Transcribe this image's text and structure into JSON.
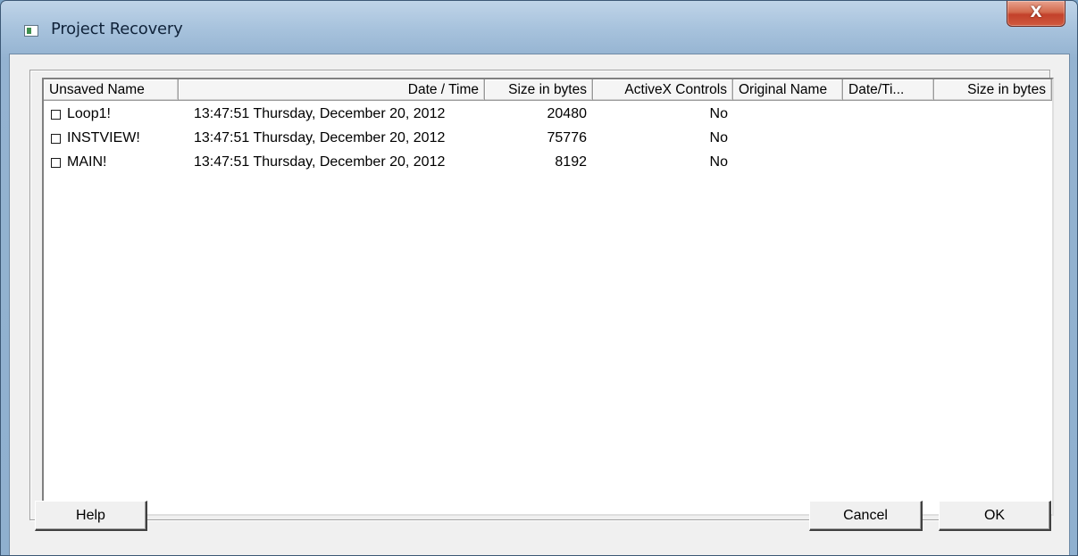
{
  "window": {
    "title": "Project Recovery",
    "close_glyph": "X",
    "icon": "window-app-icon"
  },
  "list": {
    "columns": [
      {
        "label": "Unsaved Name",
        "align": "left"
      },
      {
        "label": "Date / Time",
        "align": "right"
      },
      {
        "label": "Size in bytes",
        "align": "right"
      },
      {
        "label": "ActiveX Controls",
        "align": "right"
      },
      {
        "label": "Original Name",
        "align": "left"
      },
      {
        "label": "Date/Ti...",
        "align": "left"
      },
      {
        "label": "Size in bytes",
        "align": "right"
      }
    ],
    "rows": [
      {
        "name": "Loop1!",
        "datetime": "13:47:51 Thursday, December 20, 2012",
        "size": "20480",
        "activex": "No",
        "checked": false
      },
      {
        "name": "INSTVIEW!",
        "datetime": "13:47:51 Thursday, December 20, 2012",
        "size": "75776",
        "activex": "No",
        "checked": false
      },
      {
        "name": "MAIN!",
        "datetime": "13:47:51 Thursday, December 20, 2012",
        "size": "8192",
        "activex": "No",
        "checked": false
      }
    ]
  },
  "buttons": {
    "help": "Help",
    "cancel": "Cancel",
    "ok": "OK"
  }
}
